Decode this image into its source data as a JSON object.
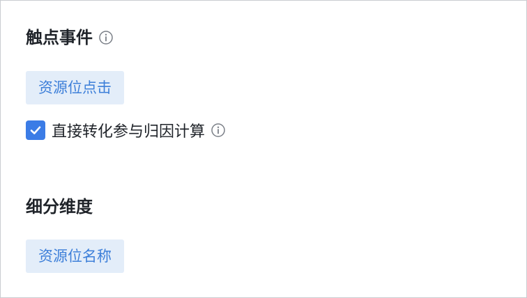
{
  "touchpoint": {
    "title": "触点事件",
    "info_icon": "info-circle-icon",
    "chip_label": "资源位点击",
    "checkbox": {
      "checked": true,
      "label": "直接转化参与归因计算",
      "info_icon": "info-circle-icon"
    }
  },
  "breakdown": {
    "title": "细分维度",
    "chip_label": "资源位名称"
  },
  "colors": {
    "accent": "#3b7ce6",
    "chip_bg": "#e3edf9",
    "chip_text": "#3d7fd9",
    "text": "#1f2329",
    "border": "#c9ccd1"
  }
}
